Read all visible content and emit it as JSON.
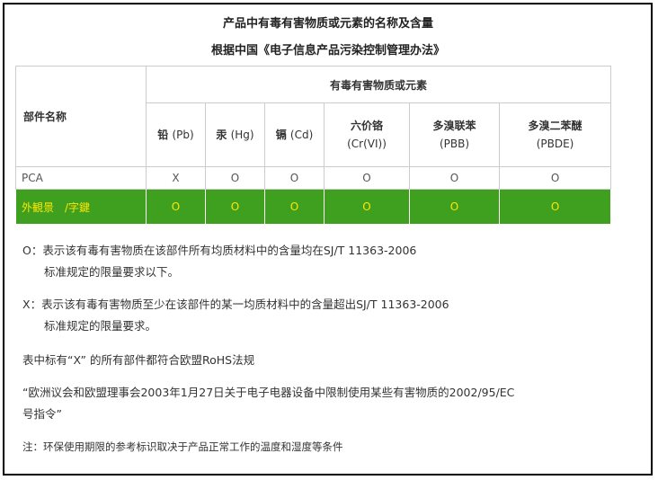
{
  "title_line1": "产品中有毒有害物质或元素的名称及含量",
  "title_line2": "根据中国《电子信息产品污染控制管理办法》",
  "table": {
    "part_header": "部件名称",
    "group_header": "有毒有害物质或元素",
    "columns": [
      {
        "cn": "铅",
        "en": "(Pb)"
      },
      {
        "cn": "汞",
        "en": "(Hg)"
      },
      {
        "cn": "镉",
        "en": "(Cd)"
      },
      {
        "cn": "六价铬",
        "en": "(Cr(VI))"
      },
      {
        "cn": "多溴联苯",
        "en": "(PBB)"
      },
      {
        "cn": "多溴二苯醚",
        "en": "(PBDE)"
      }
    ],
    "rows": [
      {
        "part": "PCA",
        "values": [
          "X",
          "O",
          "O",
          "O",
          "O",
          "O"
        ]
      },
      {
        "part": "外観景　/字鍵",
        "values": [
          "O",
          "O",
          "O",
          "O",
          "O",
          "O"
        ]
      }
    ],
    "highlight_color": "#3f9f1f",
    "highlight_text_color": "#ffe600"
  },
  "notes": {
    "o_line1": "O：表示该有毒有害物质在该部件所有均质材料中的含量均在SJ/T 11363-2006",
    "o_line2": "标准规定的限量要求以下。",
    "x_line1": "X：表示该有毒有害物质至少在该部件的某一均质材料中的含量超出SJ/T 11363-2006",
    "x_line2": "标准规定的限量要求。",
    "rohs": "表中标有“X” 的所有部件都符合欧盟RoHS法规",
    "eu_line1": "“欧洲议会和欧盟理事会2003年1月27日关于电子电器设备中限制使用某些有害物质的2002/95/EC",
    "eu_line2": "号指令”",
    "footnote": "注：环保使用期限的参考标识取决于产品正常工作的温度和湿度等条件"
  }
}
